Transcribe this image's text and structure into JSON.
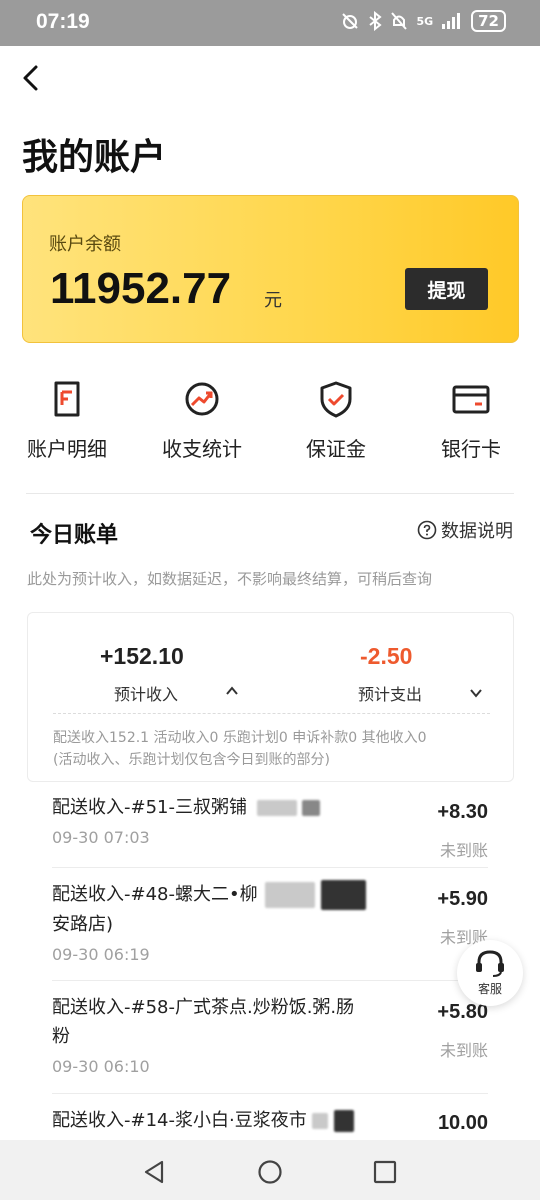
{
  "status_bar": {
    "time": "07:19",
    "network": "5G",
    "battery": "72",
    "icons": [
      "alarm-icon",
      "bluetooth-icon",
      "mute-icon",
      "signal-icon"
    ]
  },
  "header": {
    "title": "我的账户",
    "back_icon": "chevron-left-icon"
  },
  "balance": {
    "label": "账户余额",
    "amount": "11952.77",
    "unit": "元",
    "withdraw_label": "提现",
    "accent_color": "#ffd64a"
  },
  "menu": {
    "items": [
      {
        "label": "账户明细",
        "icon": "document-icon"
      },
      {
        "label": "收支统计",
        "icon": "trend-chart-icon"
      },
      {
        "label": "保证金",
        "icon": "shield-check-icon"
      },
      {
        "label": "银行卡",
        "icon": "bank-card-icon"
      }
    ]
  },
  "today": {
    "title": "今日账单",
    "data_note": "数据说明",
    "hint": "此处为预计收入，如数据延迟，不影响最终结算，可稍后查询"
  },
  "summary": {
    "income_value": "+152.10",
    "income_label": "预计收入",
    "expense_value": "-2.50",
    "expense_label": "预计支出",
    "expense_color": "#ee5a2e",
    "detail_line1": "配送收入152.1 活动收入0 乐跑计划0 申诉补款0 其他收入0",
    "detail_line2": "(活动收入、乐跑计划仅包含今日到账的部分)"
  },
  "transactions": [
    {
      "title": "配送收入-#51-三叔粥铺",
      "time": "09-30 07:03",
      "amount": "+8.30",
      "status": "未到账"
    },
    {
      "title": "配送收入-#48-螺大二•柳",
      "title_line2": "安路店)",
      "time": "09-30 06:19",
      "amount": "+5.90",
      "status": "未到账"
    },
    {
      "title": "配送收入-#58-广式茶点.炒粉饭.粥.肠",
      "title_line2": "粉",
      "time": "09-30 06:10",
      "amount": "+5.80",
      "status": "未到账"
    },
    {
      "title": "配送收入-#14-浆小白·豆浆夜市",
      "amount": "10.00"
    }
  ],
  "service": {
    "label": "客服",
    "icon": "headset-icon"
  },
  "nav": {
    "icons": [
      "nav-back-icon",
      "nav-home-icon",
      "nav-recent-icon"
    ]
  }
}
